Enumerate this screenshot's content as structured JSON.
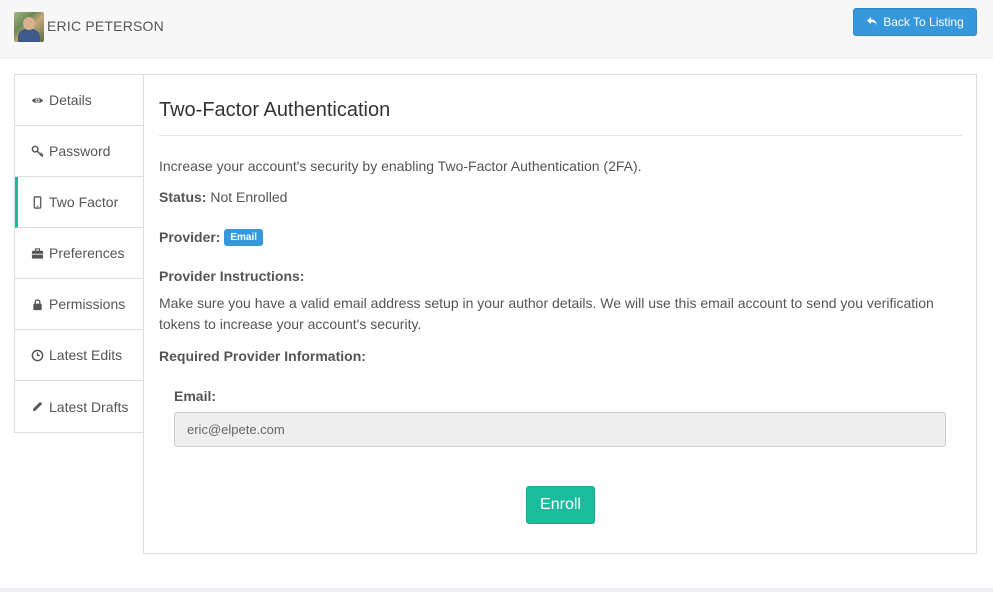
{
  "header": {
    "user_name": "ERIC PETERSON",
    "back_button_label": "Back To Listing",
    "accent_color": "#3498db"
  },
  "sidebar": {
    "active_color": "#1abc9c",
    "items": [
      {
        "label": "Details",
        "icon": "eye-icon"
      },
      {
        "label": "Password",
        "icon": "key-icon"
      },
      {
        "label": "Two Factor",
        "icon": "mobile-icon",
        "active": true
      },
      {
        "label": "Preferences",
        "icon": "briefcase-icon"
      },
      {
        "label": "Permissions",
        "icon": "lock-icon"
      },
      {
        "label": "Latest Edits",
        "icon": "clock-icon"
      },
      {
        "label": "Latest Drafts",
        "icon": "pencil-icon"
      }
    ]
  },
  "main": {
    "title": "Two-Factor Authentication",
    "intro": "Increase your account's security by enabling Two-Factor Authentication (2FA).",
    "status_label": "Status:",
    "status_value": "Not Enrolled",
    "provider_label": "Provider:",
    "provider_badge": "Email",
    "instructions_heading": "Provider Instructions:",
    "instructions_text": "Make sure you have a valid email address setup in your author details. We will use this email account to send you verification tokens to increase your account's security.",
    "required_info_heading": "Required Provider Information:",
    "email_label": "Email:",
    "email_value": "eric@elpete.com",
    "enroll_button_label": "Enroll"
  }
}
